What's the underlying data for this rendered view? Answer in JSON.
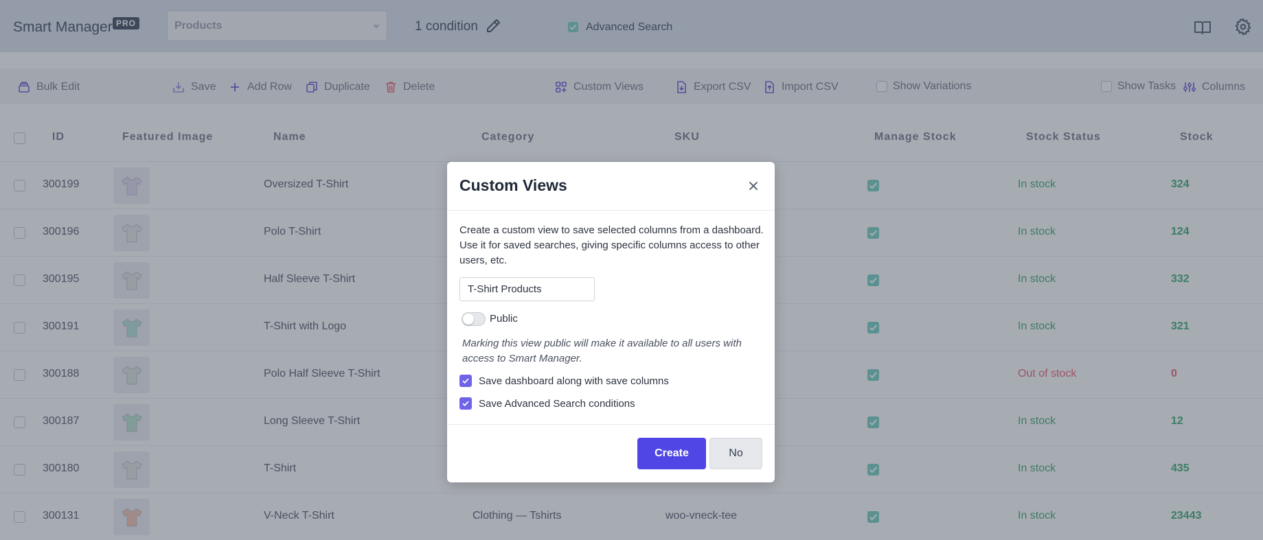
{
  "header": {
    "app_name": "Smart Manager",
    "badge": "PRO",
    "dashboard_value": "Products",
    "condition_text": "1 condition",
    "advanced_search_label": "Advanced Search"
  },
  "toolbar": {
    "bulk_edit": "Bulk Edit",
    "save": "Save",
    "add_row": "Add Row",
    "duplicate": "Duplicate",
    "delete": "Delete",
    "custom_views": "Custom Views",
    "export_csv": "Export CSV",
    "import_csv": "Import CSV",
    "show_variations": "Show Variations",
    "show_tasks": "Show Tasks",
    "columns": "Columns"
  },
  "table": {
    "headers": {
      "id": "ID",
      "featured_image": "Featured Image",
      "name": "Name",
      "category": "Category",
      "sku": "SKU",
      "manage_stock": "Manage Stock",
      "stock_status": "Stock Status",
      "stock": "Stock"
    },
    "rows": [
      {
        "id": "300199",
        "name": "Oversized T-Shirt",
        "category": "",
        "sku": "",
        "status": "In stock",
        "stock": "324",
        "shirt_color": "#e4dcf5"
      },
      {
        "id": "300196",
        "name": "Polo T-Shirt",
        "category": "",
        "sku": "",
        "status": "In stock",
        "stock": "124",
        "shirt_color": "#e8e8e8"
      },
      {
        "id": "300195",
        "name": "Half Sleeve T-Shirt",
        "category": "",
        "sku": "",
        "status": "In stock",
        "stock": "332",
        "shirt_color": "#e6e6e6"
      },
      {
        "id": "300191",
        "name": "T-Shirt with Logo",
        "category": "",
        "sku": "",
        "status": "In stock",
        "stock": "321",
        "shirt_color": "#b9e6db"
      },
      {
        "id": "300188",
        "name": "Polo Half Sleeve T-Shirt",
        "category": "",
        "sku": "",
        "status": "Out of stock",
        "stock": "0",
        "shirt_color": "#dfe7df"
      },
      {
        "id": "300187",
        "name": "Long Sleeve T-Shirt",
        "category": "",
        "sku": "",
        "status": "In stock",
        "stock": "12",
        "shirt_color": "#bfe6d2"
      },
      {
        "id": "300180",
        "name": "T-Shirt",
        "category": "",
        "sku": "",
        "status": "In stock",
        "stock": "435",
        "shirt_color": "#e6e6e6"
      },
      {
        "id": "300131",
        "name": "V-Neck T-Shirt",
        "category": "Clothing — Tshirts",
        "sku": "woo-vneck-tee",
        "status": "In stock",
        "stock": "23443",
        "shirt_color": "#f6c7b7"
      }
    ]
  },
  "modal": {
    "title": "Custom Views",
    "description": "Create a custom view to save selected columns from a dashboard. Use it for saved searches, giving specific columns access to other users, etc.",
    "view_name_value": "T-Shirt Products",
    "public_label": "Public",
    "public_note": "Marking this view public will make it available to all users with access to Smart Manager.",
    "option_save_dashboard": "Save dashboard along with save columns",
    "option_save_search": "Save Advanced Search conditions",
    "create_label": "Create",
    "no_label": "No"
  },
  "colors": {
    "accent": "#4f46e5",
    "checkbox_accent": "#6f64e7",
    "in_stock": "#4caf7d",
    "out_of_stock": "#ef6b7e"
  }
}
